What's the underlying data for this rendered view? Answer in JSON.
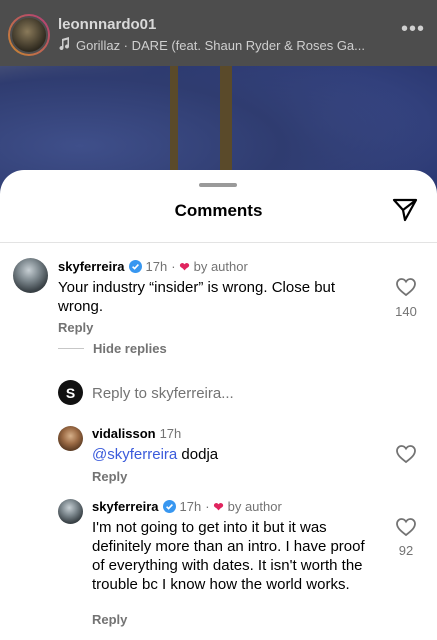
{
  "post": {
    "username": "leonnnardo01",
    "song": "Gorillaz · DARE (feat. Shaun Ryder & Roses Ga...",
    "icons": {
      "more": "more-horizontal-icon",
      "music": "music-note-icon"
    }
  },
  "sheet": {
    "title": "Comments",
    "share_icon": "send-icon"
  },
  "comments": [
    {
      "username": "skyferreira",
      "verified": true,
      "time": "17h",
      "author_tag": "by author",
      "text": "Your industry “insider” is wrong. Close but wrong.",
      "reply_label": "Reply",
      "likes": "140"
    }
  ],
  "thread": {
    "hide_replies": "Hide replies",
    "reply_to_prompt": "Reply to skyferreira...",
    "reply_avatar_letter": "S"
  },
  "replies": [
    {
      "username": "vidalisson",
      "time": "17h",
      "mention": "@skyferreira",
      "text": " dodja",
      "reply_label": "Reply"
    },
    {
      "username": "skyferreira",
      "verified": true,
      "time": "17h",
      "author_tag": "by author",
      "text": "I'm not going to get into it but it was definitely more than an intro. I have proof of everything with dates. It isn't worth the trouble bc I know how the world works.",
      "reply_label": "Reply",
      "likes": "92"
    }
  ],
  "colors": {
    "accent_link": "#3b5bdb",
    "verified_blue": "#3897f0",
    "heart_red": "#e0245e"
  }
}
